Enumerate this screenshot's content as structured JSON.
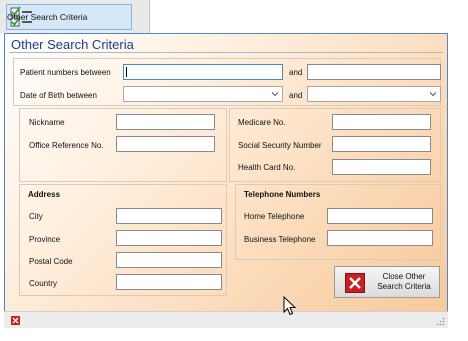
{
  "toolbar": {
    "button_label": "Other Search Criteria"
  },
  "dialog": {
    "title": "Other Search Criteria",
    "patient_numbers": {
      "label": "Patient numbers between",
      "and_label": "and",
      "from_value": "",
      "to_value": ""
    },
    "dob": {
      "label": "Date of Birth between",
      "and_label": "and",
      "from_value": "",
      "to_value": ""
    },
    "ids": {
      "nickname": "Nickname",
      "office_ref": "Office Reference No."
    },
    "health": {
      "medicare": "Medicare No.",
      "ssn": "Social Security Number",
      "health_card": "Health Card No."
    },
    "address": {
      "header": "Address",
      "city": "City",
      "province": "Province",
      "postal": "Postal Code",
      "country": "Country"
    },
    "phones": {
      "header": "Telephone Numbers",
      "home": "Home Telephone",
      "business": "Business Telephone"
    },
    "close_button": {
      "line1": "Close Other",
      "line2": "Search Criteria"
    }
  },
  "colors": {
    "accent": "#4a88c7",
    "title": "#1a3f8a",
    "close_red": "#c9201f"
  },
  "icons": [
    "checklist-icon",
    "dropdown-chevron-icon",
    "close-x-icon",
    "resize-grip-icon",
    "mouse-cursor-icon"
  ]
}
